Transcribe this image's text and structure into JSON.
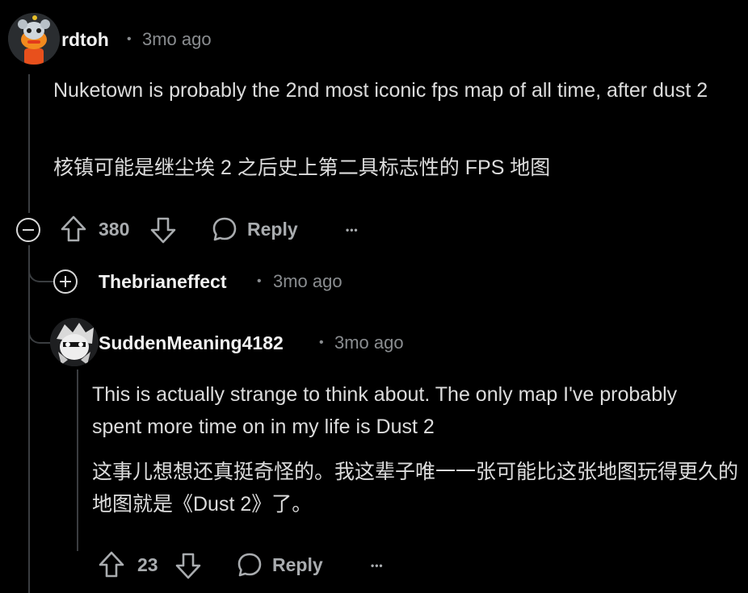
{
  "comments": [
    {
      "username": "rdtoh",
      "separator": "•",
      "time": "3mo ago",
      "text_en": "Nuketown is probably the 2nd most iconic fps map of all time, after dust 2",
      "text_zh": "核镇可能是继尘埃 2 之后史上第二具标志性的 FPS 地图",
      "votes": "380",
      "reply_label": "Reply",
      "more_label": "•••"
    },
    {
      "username": "Thebrianeffect",
      "separator": "•",
      "time": "3mo ago"
    },
    {
      "username": "SuddenMeaning4182",
      "separator": "•",
      "time": "3mo ago",
      "text_en": "This is actually strange to think about. The only map I've probably spent more time on in my life is Dust 2",
      "text_zh": "这事儿想想还真挺奇怪的。我这辈子唯一一张可能比这张地图玩得更久的地图就是《Dust 2》了。",
      "votes": "23",
      "reply_label": "Reply",
      "more_label": "•••"
    }
  ],
  "colors": {
    "background": "#000000",
    "thread_line": "#3a3d40",
    "meta_text": "#8a8d90",
    "username": "#f2f2f2"
  },
  "icons": [
    "upvote-icon",
    "downvote-icon",
    "reply-bubble-icon",
    "collapse-icon",
    "expand-icon",
    "more-icon"
  ]
}
